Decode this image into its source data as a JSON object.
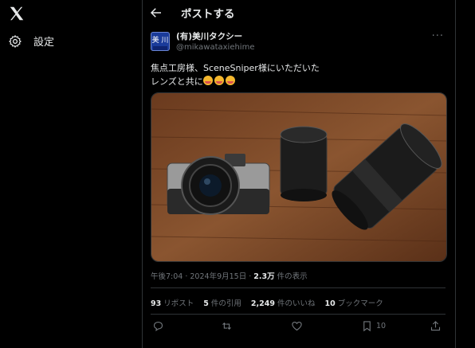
{
  "sidebar": {
    "logo_icon": "x-logo-icon",
    "settings_label": "設定"
  },
  "header": {
    "title": "ポストする"
  },
  "post": {
    "display_name": "(有)美川タクシー",
    "handle": "@mikawataxiehime",
    "avatar_text": "美 川",
    "text_line1": "焦点工房様、SceneSniper様にいただいた",
    "text_line2": "レンズと共に",
    "emoji_count": 3,
    "time": "午後7:04 · 2024年9月15日 · ",
    "views_value": "2.3万",
    "views_label": " 件の表示"
  },
  "stats": {
    "reposts_value": "93",
    "reposts_label": "リポスト",
    "quotes_value": "5",
    "quotes_label": "件の引用",
    "likes_value": "2,249",
    "likes_label": "件のいいね",
    "bookmarks_value": "10",
    "bookmarks_label": "ブックマーク"
  },
  "actions": {
    "bookmark_count": "10"
  },
  "colors": {
    "background": "#000000",
    "text": "#e7e9ea",
    "muted": "#71767b",
    "border": "#2f3336"
  }
}
